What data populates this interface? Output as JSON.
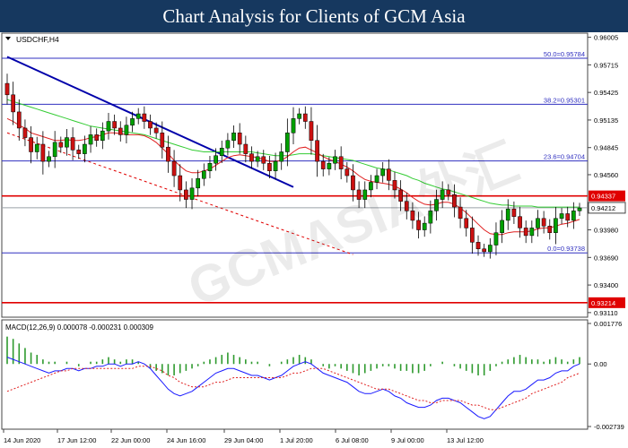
{
  "header": {
    "title": "Chart Analysis for Clients of GCM Asia"
  },
  "watermark": "GCMASIA外汇",
  "colors": {
    "header_bg": "#16385f",
    "candle_up": "#00a000",
    "candle_down": "#cc1111",
    "ma_fast": "#e02020",
    "ma_slow": "#33cc33",
    "trendline": "#0000aa",
    "fib_line": "#3030c0",
    "resistance": "#e00000",
    "current_price": "#9aa0a6",
    "macd_line": "#1a1aff",
    "signal_line": "#e02020",
    "histogram": "#2e9a2e"
  },
  "chart_data": [
    {
      "type": "candlestick",
      "symbol": "USDCHF,H4",
      "x_ticks": [
        "14 Jun 2020",
        "17 Jun 12:00",
        "22 Jun 00:00",
        "24 Jun 16:00",
        "29 Jun 04:00",
        "1 Jul 20:00",
        "6 Jul 08:00",
        "9 Jul 00:00",
        "13 Jul 12:00"
      ],
      "y_ticks": [
        "0.96005",
        "0.95715",
        "0.95425",
        "0.95135",
        "0.94845",
        "0.94560",
        "0.93980",
        "0.93690",
        "0.93400",
        "0.93110"
      ],
      "ylim": [
        0.9309,
        0.9602
      ],
      "fibonacci_levels": [
        {
          "label": "50.0=0.95784",
          "value": 0.95784
        },
        {
          "label": "38.2=0.95301",
          "value": 0.95301
        },
        {
          "label": "23.6=0.94704",
          "value": 0.94704
        },
        {
          "label": "0.0=0.93738",
          "value": 0.93738
        }
      ],
      "resistance_levels": [
        {
          "label": "0.94337",
          "value": 0.94337
        },
        {
          "label": "0.93214",
          "value": 0.93214
        }
      ],
      "current_price": {
        "label": "0.94212",
        "value": 0.94212
      },
      "close": [
        0.954,
        0.9522,
        0.9505,
        0.9495,
        0.948,
        0.9488,
        0.947,
        0.9475,
        0.949,
        0.9485,
        0.9495,
        0.9482,
        0.9478,
        0.9488,
        0.9498,
        0.9492,
        0.9502,
        0.9512,
        0.9505,
        0.9498,
        0.9508,
        0.9515,
        0.952,
        0.9512,
        0.9505,
        0.95,
        0.9485,
        0.947,
        0.9455,
        0.944,
        0.943,
        0.9442,
        0.9452,
        0.946,
        0.9468,
        0.9476,
        0.9484,
        0.9492,
        0.95,
        0.9488,
        0.9478,
        0.947,
        0.9475,
        0.9468,
        0.946,
        0.947,
        0.948,
        0.95,
        0.9515,
        0.952,
        0.9512,
        0.9492,
        0.947,
        0.9462,
        0.9468,
        0.9475,
        0.9462,
        0.9455,
        0.944,
        0.943,
        0.944,
        0.9448,
        0.9455,
        0.9462,
        0.945,
        0.944,
        0.9428,
        0.9418,
        0.9408,
        0.9398,
        0.9405,
        0.9418,
        0.943,
        0.944,
        0.9435,
        0.9422,
        0.941,
        0.94,
        0.9385,
        0.9378,
        0.9375,
        0.9382,
        0.9395,
        0.9408,
        0.942,
        0.9412,
        0.94,
        0.9392,
        0.94,
        0.941,
        0.9402,
        0.9395,
        0.941,
        0.9415,
        0.9408,
        0.9418,
        0.9421
      ],
      "ma_fast": [
        0.9515,
        0.9512,
        0.9508,
        0.9505,
        0.95,
        0.9498,
        0.9496,
        0.9494,
        0.9492,
        0.9492,
        0.9493,
        0.9492,
        0.9492,
        0.9493,
        0.9495,
        0.9496,
        0.9498,
        0.95,
        0.95,
        0.9499,
        0.9498,
        0.9498,
        0.9498,
        0.9497,
        0.9494,
        0.949,
        0.9484,
        0.9478,
        0.9471,
        0.9465,
        0.946,
        0.9458,
        0.9458,
        0.946,
        0.9462,
        0.9466,
        0.947,
        0.9474,
        0.9476,
        0.9477,
        0.9476,
        0.9475,
        0.9474,
        0.9472,
        0.947,
        0.947,
        0.9471,
        0.9475,
        0.948,
        0.9484,
        0.9485,
        0.9482,
        0.9479,
        0.9475,
        0.9472,
        0.947,
        0.9467,
        0.9464,
        0.946,
        0.9455,
        0.9451,
        0.9449,
        0.9448,
        0.9447,
        0.9446,
        0.9444,
        0.9441,
        0.9437,
        0.9432,
        0.9428,
        0.9425,
        0.9424,
        0.9425,
        0.9427,
        0.9427,
        0.9425,
        0.9421,
        0.9416,
        0.941,
        0.9404,
        0.9398,
        0.9394,
        0.9393,
        0.9393,
        0.9395,
        0.9396,
        0.9396,
        0.9396,
        0.9397,
        0.9399,
        0.94,
        0.94,
        0.9402,
        0.9404,
        0.9405,
        0.9407,
        0.9409
      ],
      "ma_slow": [
        0.9535,
        0.9533,
        0.9531,
        0.9529,
        0.9527,
        0.9525,
        0.9523,
        0.9521,
        0.9519,
        0.9517,
        0.9515,
        0.9513,
        0.9511,
        0.9509,
        0.9507,
        0.9506,
        0.9505,
        0.9504,
        0.9503,
        0.9502,
        0.9501,
        0.95,
        0.9499,
        0.9498,
        0.9496,
        0.9494,
        0.9492,
        0.949,
        0.9488,
        0.9486,
        0.9484,
        0.9482,
        0.9481,
        0.948,
        0.948,
        0.948,
        0.948,
        0.948,
        0.948,
        0.948,
        0.948,
        0.948,
        0.9479,
        0.9478,
        0.9477,
        0.9476,
        0.9476,
        0.9476,
        0.9477,
        0.9478,
        0.9478,
        0.9478,
        0.9477,
        0.9476,
        0.9475,
        0.9474,
        0.9473,
        0.9472,
        0.9471,
        0.9469,
        0.9467,
        0.9465,
        0.9463,
        0.9462,
        0.9461,
        0.9459,
        0.9457,
        0.9455,
        0.9452,
        0.945,
        0.9447,
        0.9445,
        0.9443,
        0.9441,
        0.944,
        0.9438,
        0.9436,
        0.9434,
        0.9432,
        0.943,
        0.9428,
        0.9426,
        0.9425,
        0.9424,
        0.9424,
        0.9423,
        0.9423,
        0.9423,
        0.9423,
        0.9422,
        0.9422,
        0.9422,
        0.9422,
        0.9422,
        0.9422,
        0.9422,
        0.9422
      ],
      "trendline": [
        {
          "i": 0,
          "v": 0.958
        },
        {
          "i": 48,
          "v": 0.9443
        }
      ],
      "dashed_trendline": [
        {
          "i": 0,
          "v": 0.95
        },
        {
          "i": 58,
          "v": 0.9372
        }
      ]
    },
    {
      "type": "macd",
      "label": "MACD(12,26,9) 0.000078 -0.000231 0.000309",
      "y_ticks": [
        "0.001776",
        "0.00",
        "-0.002739"
      ],
      "ylim": [
        -0.002739,
        0.001776
      ],
      "histogram": [
        0.0012,
        0.0011,
        0.0009,
        0.0007,
        0.0005,
        0.0004,
        0.0002,
        0.0001,
        0.0001,
        0.0,
        0.0001,
        0.0,
        -0.0001,
        0.0,
        0.0001,
        0.0001,
        0.0002,
        0.0003,
        0.0002,
        0.0001,
        0.0002,
        0.0002,
        0.0001,
        0.0,
        -0.0002,
        -0.0003,
        -0.0004,
        -0.0005,
        -0.0005,
        -0.0004,
        -0.0003,
        -0.0002,
        -0.0001,
        0.0001,
        0.0002,
        0.0003,
        0.0004,
        0.0005,
        0.0004,
        0.0003,
        0.0002,
        0.0001,
        0.0001,
        0.0,
        -0.0001,
        0.0,
        0.0001,
        0.0002,
        0.0003,
        0.0004,
        0.0003,
        0.0002,
        0.0,
        -0.0001,
        -0.0002,
        -0.0001,
        -0.0002,
        -0.0003,
        -0.0004,
        -0.0005,
        -0.0004,
        -0.0003,
        -0.0002,
        -0.0001,
        -0.0001,
        -0.0002,
        -0.0003,
        -0.0003,
        -0.0004,
        -0.0004,
        -0.0003,
        -0.0001,
        0.0,
        0.0001,
        0.0,
        -0.0001,
        -0.0002,
        -0.0003,
        -0.0004,
        -0.0005,
        -0.0005,
        -0.0003,
        -0.0001,
        0.0001,
        0.0002,
        0.0003,
        0.0004,
        0.0003,
        0.0002,
        0.0002,
        0.0001,
        0.0002,
        0.0003,
        0.0002,
        0.0001,
        0.0002,
        0.0003
      ],
      "macd": [
        0.0003,
        0.0002,
        0.0001,
        0.0,
        -0.0001,
        -0.0002,
        -0.0003,
        -0.0004,
        -0.0003,
        -0.0003,
        -0.0002,
        -0.0002,
        -0.0003,
        -0.0002,
        -0.0002,
        -0.0001,
        -0.0001,
        0.0,
        0.0,
        -0.0001,
        0.0,
        0.0,
        0.0001,
        0.0,
        -0.0002,
        -0.0005,
        -0.0008,
        -0.0011,
        -0.0013,
        -0.0014,
        -0.0013,
        -0.0012,
        -0.001,
        -0.0008,
        -0.0006,
        -0.0004,
        -0.0003,
        -0.0002,
        -0.0002,
        -0.0003,
        -0.0004,
        -0.0005,
        -0.0005,
        -0.0006,
        -0.0007,
        -0.0006,
        -0.0005,
        -0.0003,
        -0.0001,
        0.0,
        0.0001,
        0.0,
        -0.0002,
        -0.0004,
        -0.0005,
        -0.0006,
        -0.0007,
        -0.0008,
        -0.001,
        -0.0012,
        -0.0013,
        -0.0013,
        -0.0012,
        -0.0011,
        -0.0012,
        -0.0014,
        -0.0015,
        -0.0017,
        -0.0018,
        -0.0019,
        -0.0019,
        -0.0018,
        -0.0016,
        -0.0015,
        -0.0015,
        -0.0016,
        -0.0017,
        -0.0019,
        -0.0021,
        -0.0023,
        -0.0024,
        -0.0023,
        -0.002,
        -0.0017,
        -0.0014,
        -0.0012,
        -0.0012,
        -0.0011,
        -0.0009,
        -0.0007,
        -0.0007,
        -0.0006,
        -0.0004,
        -0.0003,
        -0.0003,
        -0.0001,
        0.0
      ],
      "signal": [
        -0.0012,
        -0.0011,
        -0.001,
        -0.0009,
        -0.0008,
        -0.0007,
        -0.0006,
        -0.0005,
        -0.0004,
        -0.0003,
        -0.0003,
        -0.0002,
        -0.0002,
        -0.0002,
        -0.0002,
        -0.0002,
        -0.0002,
        -0.0002,
        -0.0002,
        -0.0002,
        -0.0002,
        -0.0002,
        -0.0001,
        -0.0001,
        -0.0001,
        -0.0002,
        -0.0003,
        -0.0005,
        -0.0006,
        -0.0008,
        -0.0009,
        -0.001,
        -0.001,
        -0.001,
        -0.0009,
        -0.0008,
        -0.0008,
        -0.0007,
        -0.0006,
        -0.0006,
        -0.0006,
        -0.0006,
        -0.0006,
        -0.0006,
        -0.0006,
        -0.0006,
        -0.0006,
        -0.0005,
        -0.0004,
        -0.0004,
        -0.0003,
        -0.0002,
        -0.0002,
        -0.0002,
        -0.0003,
        -0.0004,
        -0.0005,
        -0.0006,
        -0.0007,
        -0.0008,
        -0.0009,
        -0.001,
        -0.0011,
        -0.0011,
        -0.0011,
        -0.0012,
        -0.0013,
        -0.0014,
        -0.0015,
        -0.0016,
        -0.0016,
        -0.0017,
        -0.0017,
        -0.0016,
        -0.0016,
        -0.0016,
        -0.0016,
        -0.0017,
        -0.0018,
        -0.0018,
        -0.0019,
        -0.002,
        -0.002,
        -0.0019,
        -0.0018,
        -0.0017,
        -0.0016,
        -0.0015,
        -0.0013,
        -0.0012,
        -0.0011,
        -0.001,
        -0.0009,
        -0.0008,
        -0.0006,
        -0.0005,
        -0.0004
      ]
    }
  ]
}
